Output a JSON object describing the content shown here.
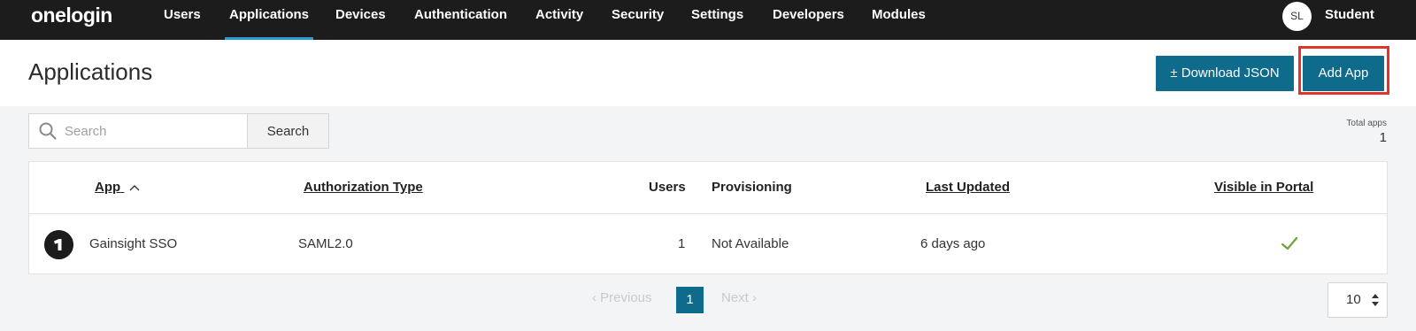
{
  "nav": {
    "logo": "onelogin",
    "items": [
      {
        "label": "Users",
        "active": false
      },
      {
        "label": "Applications",
        "active": true
      },
      {
        "label": "Devices",
        "active": false
      },
      {
        "label": "Authentication",
        "active": false
      },
      {
        "label": "Activity",
        "active": false
      },
      {
        "label": "Security",
        "active": false
      },
      {
        "label": "Settings",
        "active": false
      },
      {
        "label": "Developers",
        "active": false
      },
      {
        "label": "Modules",
        "active": false
      }
    ],
    "user_initials": "SL",
    "user_name": "Student"
  },
  "header": {
    "title": "Applications",
    "download_label": "± Download JSON",
    "add_label": "Add App"
  },
  "search": {
    "placeholder": "Search",
    "button_label": "Search"
  },
  "totals": {
    "label": "Total apps",
    "count": "1"
  },
  "table": {
    "columns": {
      "app": "App",
      "auth_type": "Authorization Type",
      "users": "Users",
      "provisioning": "Provisioning",
      "last_updated": "Last Updated",
      "visible": "Visible in Portal"
    },
    "rows": [
      {
        "icon": "onelogin-app-icon",
        "app": "Gainsight SSO",
        "auth_type": "SAML2.0",
        "users": "1",
        "provisioning": "Not Available",
        "last_updated": "6 days ago",
        "visible": true
      }
    ]
  },
  "pagination": {
    "prev_label": "‹ Previous",
    "current_page": "1",
    "next_label": "Next ›",
    "per_page": "10"
  },
  "colors": {
    "nav_bg": "#1c1c1c",
    "accent": "#0e6b8c",
    "active_tab": "#2b9bd1",
    "highlight": "#e4332b",
    "check": "#6aa834"
  }
}
